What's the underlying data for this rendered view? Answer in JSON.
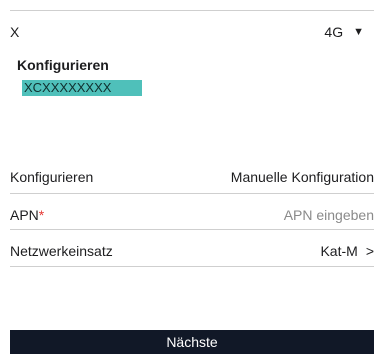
{
  "network": {
    "label": "X",
    "selected": "4G"
  },
  "config": {
    "title": "Konfigurieren",
    "highlighted_value": "XCXXXXXXXX"
  },
  "rows": [
    {
      "label": "Konfigurieren",
      "value": "Manuelle Konfiguration"
    },
    {
      "label": "APN",
      "required_mark": "*",
      "placeholder": "APN eingeben"
    },
    {
      "label": "Netzwerkeinsatz",
      "value": "Kat-M",
      "chevron": ">"
    }
  ],
  "footer": {
    "next_label": "Nächste"
  },
  "colors": {
    "highlight": "#4fc0ba",
    "button_bg": "#111827",
    "required": "#e53935"
  }
}
